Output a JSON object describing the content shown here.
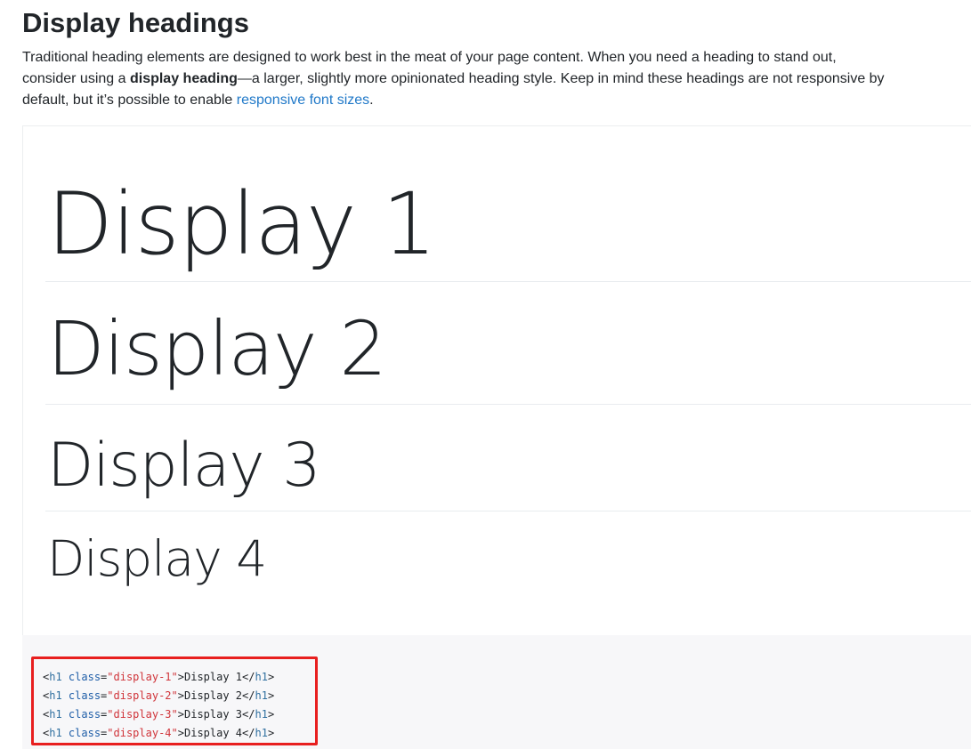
{
  "section": {
    "title": "Display headings"
  },
  "intro": {
    "line1": "Traditional heading elements are designed to work best in the meat of your page content. When you need a heading to stand out,",
    "line2_before": "consider using a ",
    "line2_bold": "display heading",
    "line2_after": "—a larger, slightly more opinionated heading style. Keep in mind these headings are not responsive by",
    "line3_before": "default, but it’s possible to enable ",
    "line3_link": "responsive font sizes",
    "line3_after": "."
  },
  "examples": [
    {
      "text": "Display 1"
    },
    {
      "text": "Display 2"
    },
    {
      "text": "Display 3"
    },
    {
      "text": "Display 4"
    }
  ],
  "code_lines": [
    {
      "open_lt": "<",
      "tag": "h1",
      "attr": "class",
      "eq": "=",
      "value": "\"display-1\"",
      "close_gt": ">",
      "text": "Display 1",
      "end": "</",
      "end_tag": "h1",
      "end_gt": ">"
    },
    {
      "open_lt": "<",
      "tag": "h1",
      "attr": "class",
      "eq": "=",
      "value": "\"display-2\"",
      "close_gt": ">",
      "text": "Display 2",
      "end": "</",
      "end_tag": "h1",
      "end_gt": ">"
    },
    {
      "open_lt": "<",
      "tag": "h1",
      "attr": "class",
      "eq": "=",
      "value": "\"display-3\"",
      "close_gt": ">",
      "text": "Display 3",
      "end": "</",
      "end_tag": "h1",
      "end_gt": ">"
    },
    {
      "open_lt": "<",
      "tag": "h1",
      "attr": "class",
      "eq": "=",
      "value": "\"display-4\"",
      "close_gt": ">",
      "text": "Display 4",
      "end": "</",
      "end_tag": "h1",
      "end_gt": ">"
    }
  ],
  "colors": {
    "link": "#1f78c8",
    "highlight_border": "#e81f1f",
    "code_background": "#f7f7f9",
    "code_string": "#d0343a",
    "code_tag": "#2f6f9f"
  }
}
